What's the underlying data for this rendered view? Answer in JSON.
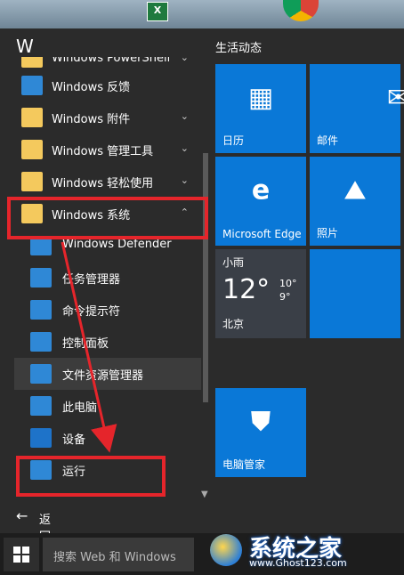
{
  "top": {
    "excel_icon_text": "X"
  },
  "start_menu": {
    "letter_heading": "W",
    "items": [
      {
        "label": "Windows PowerShell",
        "chevron": "⌄",
        "icon": "folder-icon",
        "sub": false
      },
      {
        "label": "Windows 反馈",
        "chevron": "",
        "icon": "feedback-icon",
        "sub": false
      },
      {
        "label": "Windows 附件",
        "chevron": "⌄",
        "icon": "folder-icon",
        "sub": false
      },
      {
        "label": "Windows 管理工具",
        "chevron": "⌄",
        "icon": "folder-icon",
        "sub": false
      },
      {
        "label": "Windows 轻松使用",
        "chevron": "⌄",
        "icon": "folder-icon",
        "sub": false
      },
      {
        "label": "Windows 系统",
        "chevron": "⌃",
        "icon": "folder-icon",
        "sub": false
      },
      {
        "label": "Windows Defender",
        "chevron": "",
        "icon": "defender-icon",
        "sub": true
      },
      {
        "label": "任务管理器",
        "chevron": "",
        "icon": "task-manager-icon",
        "sub": true
      },
      {
        "label": "命令提示符",
        "chevron": "",
        "icon": "command-prompt-icon",
        "sub": true
      },
      {
        "label": "控制面板",
        "chevron": "",
        "icon": "control-panel-icon",
        "sub": true
      },
      {
        "label": "文件资源管理器",
        "chevron": "",
        "icon": "file-explorer-icon",
        "sub": true
      },
      {
        "label": "此电脑",
        "chevron": "",
        "icon": "this-pc-icon",
        "sub": true
      },
      {
        "label": "设备",
        "chevron": "",
        "icon": "gear-icon",
        "sub": true
      },
      {
        "label": "运行",
        "chevron": "",
        "icon": "run-icon",
        "sub": true
      }
    ],
    "back_label": "返回"
  },
  "tiles": {
    "group_title": "生活动态",
    "calendar_label": "日历",
    "mail_label": "邮件",
    "edge_label": "Microsoft Edge",
    "photos_label": "照片",
    "weather": {
      "condition": "小雨",
      "temp": "12°",
      "high": "10°",
      "low": "9°",
      "location": "北京"
    },
    "security_label": "电脑管家"
  },
  "taskbar": {
    "search_placeholder": "搜索 Web 和 Windows"
  },
  "watermark": {
    "title": "系统之家",
    "url": "www.Ghost123.com"
  },
  "colors": {
    "tile_blue": "#0a78d7",
    "highlight_red": "#e5252b",
    "folder_yellow": "#f4c95d"
  }
}
